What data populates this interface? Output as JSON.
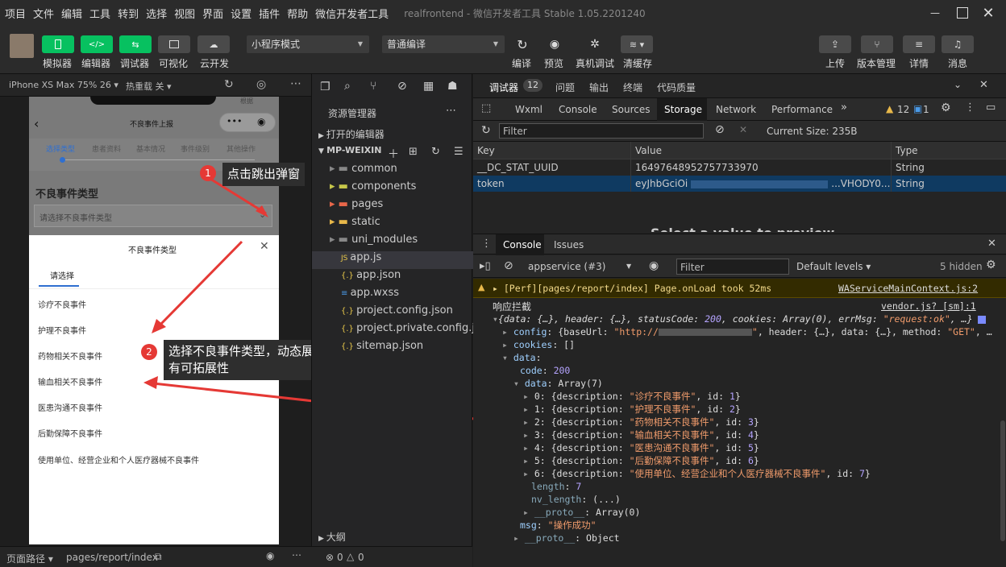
{
  "menu": [
    "项目",
    "文件",
    "编辑",
    "工具",
    "转到",
    "选择",
    "视图",
    "界面",
    "设置",
    "插件",
    "帮助",
    "微信开发者工具"
  ],
  "app_title": "realfrontend - 微信开发者工具 Stable 1.05.2201240",
  "toolbar": {
    "left_buttons": [
      "模拟器",
      "编辑器",
      "调试器",
      "可视化",
      "云开发"
    ],
    "mode_select": "小程序模式",
    "compile_select": "普通编译",
    "middle_buttons": [
      "编译",
      "预览",
      "真机调试",
      "清缓存"
    ],
    "right_buttons": [
      "上传",
      "版本管理",
      "详情",
      "消息"
    ]
  },
  "sim": {
    "device": "iPhone XS Max 75% 26 ▾",
    "hotreload": "热重载 关 ▾"
  },
  "phone": {
    "nav_title": "不良事件上报",
    "steps": [
      "选择类型",
      "患者资料",
      "基本情况",
      "事件级别",
      "其他操作"
    ],
    "section_title": "不良事件类型",
    "select_placeholder": "请选择不良事件类型",
    "sheet_title": "不良事件类型",
    "sheet_tab": "请选择",
    "options": [
      "诊疗不良事件",
      "护理不良事件",
      "药物相关不良事件",
      "输血相关不良事件",
      "医患沟通不良事件",
      "后勤保障不良事件",
      "使用单位、经营企业和个人医疗器械不良事件"
    ],
    "status_right": "根据"
  },
  "annotations": [
    {
      "num": "1",
      "text": "点击跳出弹窗"
    },
    {
      "num": "2",
      "text": "选择不良事件类型，动态展示，具有可拓展性"
    }
  ],
  "status": {
    "path_label": "页面路径 ▾",
    "path": "pages/report/index",
    "errors": "0",
    "warnings": "0"
  },
  "explorer": {
    "title": "资源管理器",
    "open_editors": "打开的编辑器",
    "project": "MP-WEIXIN",
    "items": [
      "common",
      "components",
      "pages",
      "static",
      "uni_modules",
      "app.js",
      "app.json",
      "app.wxss",
      "project.config.json",
      "project.private.config.js...",
      "sitemap.json"
    ],
    "outline": "大纲"
  },
  "devtools": {
    "top_tabs": [
      "调试器",
      "问题",
      "输出",
      "终端",
      "代码质量"
    ],
    "debugger_count": "12",
    "tabs": [
      "Wxml",
      "Console",
      "Sources",
      "Storage",
      "Network",
      "Performance"
    ],
    "warn_count": "12",
    "info_count": "1",
    "filter_placeholder": "Filter",
    "current_size": "Current Size: 235B",
    "columns": [
      "Key",
      "Value",
      "Type"
    ],
    "rows": [
      {
        "key": "__DC_STAT_UUID",
        "value": "16497648952757733970",
        "type": "String"
      },
      {
        "key": "token",
        "value": "eyJhbGciOi",
        "value_tail": "...VHODY0...",
        "type": "String"
      }
    ],
    "select_hint": "Select a value to preview",
    "console_tabs": [
      "Console",
      "Issues"
    ],
    "context": "appservice (#3)",
    "levels": "Default levels ▾",
    "hidden": "5 hidden",
    "perf_warn": "▸ [Perf][pages/report/index] Page.onLoad took 52ms",
    "perf_src": "WAServiceMainContext.js:2",
    "intercept": "响应拦截",
    "intercept_src": "vendor.js? [sm]:1"
  }
}
